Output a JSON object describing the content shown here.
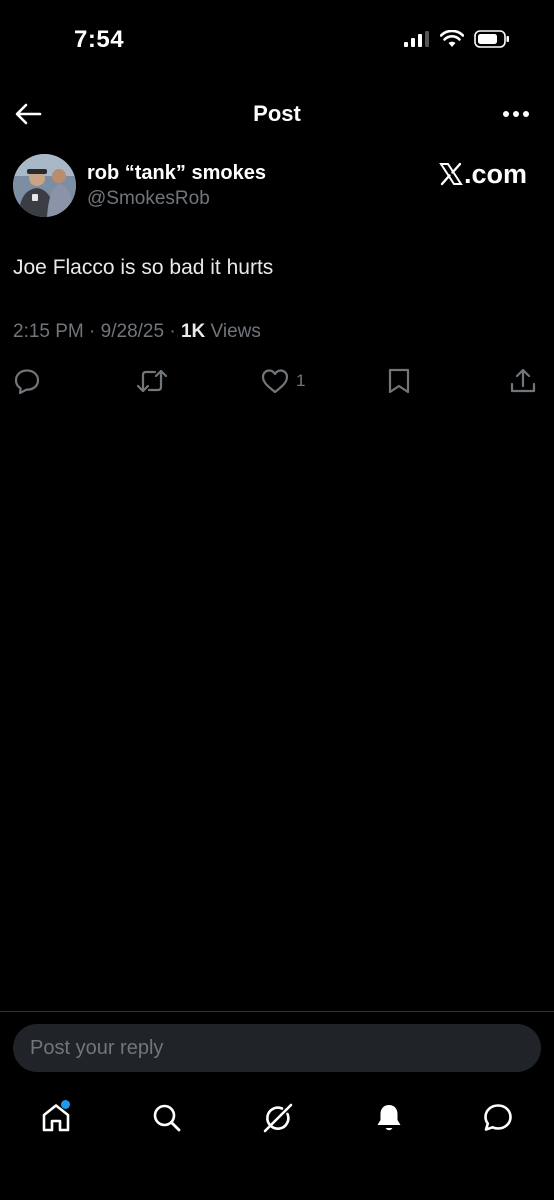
{
  "status_bar": {
    "time": "7:54"
  },
  "header": {
    "title": "Post"
  },
  "author": {
    "display_name": "rob “tank” smokes",
    "handle": "@SmokesRob"
  },
  "watermark": {
    "text": ".com"
  },
  "post": {
    "text": "Joe Flacco is so bad it hurts",
    "time": "2:15 PM",
    "date": "9/28/25",
    "views_count": "1K",
    "views_label": "Views",
    "separator": "·"
  },
  "actions": {
    "reply_icon": "reply-icon",
    "repost_icon": "repost-icon",
    "like_icon": "heart-icon",
    "like_count": "1",
    "bookmark_icon": "bookmark-icon",
    "share_icon": "share-icon"
  },
  "reply_box": {
    "placeholder": "Post your reply"
  },
  "tab_bar": {
    "items": [
      "home-icon",
      "search-icon",
      "grok-icon",
      "notifications-icon",
      "messages-icon"
    ]
  },
  "colors": {
    "background": "#000000",
    "primary_text": "#e7e9ea",
    "secondary_text": "#71767b",
    "accent": "#1d9bf0",
    "input_bg": "#202327"
  }
}
